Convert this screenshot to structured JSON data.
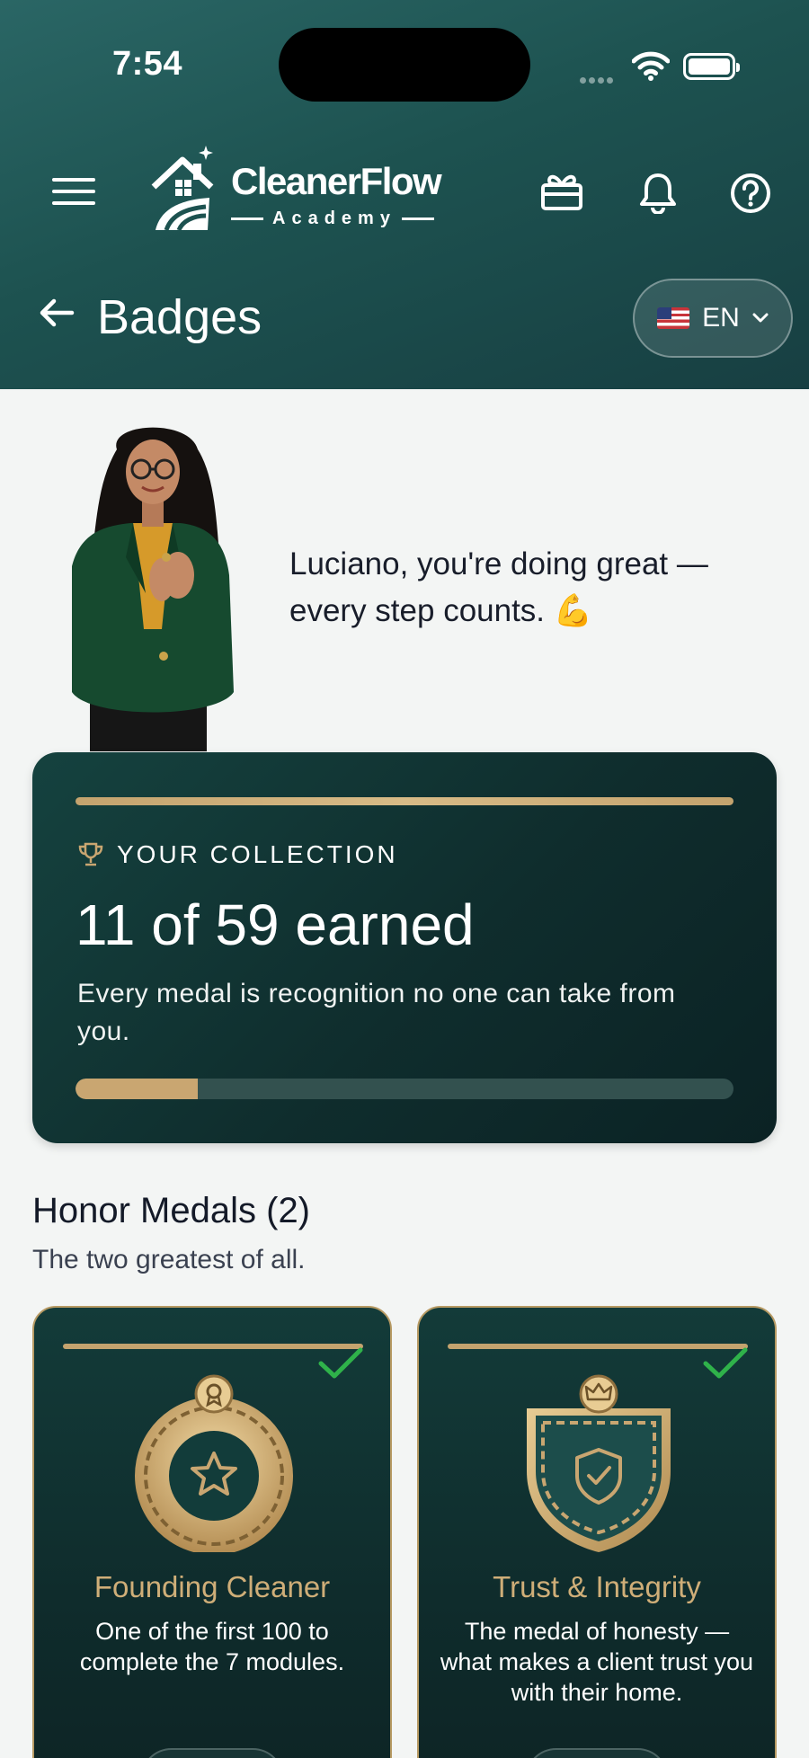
{
  "status_bar": {
    "time": "7:54"
  },
  "header": {
    "logo_title": "CleanerFlow",
    "logo_subtitle": "Academy",
    "page_title": "Badges",
    "language": "EN"
  },
  "mentor": {
    "message": "Luciano, you're doing great — every step counts. 💪"
  },
  "collection": {
    "kicker": "YOUR COLLECTION",
    "count_text": "11 of 59 earned",
    "earned": 11,
    "total": 59,
    "description": "Every medal is recognition no one can take from you."
  },
  "honor_section": {
    "title": "Honor Medals (2)",
    "subtitle": "The two greatest of all.",
    "medals": [
      {
        "name": "Founding Cleaner",
        "description": "One of the first 100 to complete the 7 modules.",
        "earned": true,
        "icon": "star-ring-medal-icon"
      },
      {
        "name": "Trust & Integrity",
        "description": "The medal of honesty — what makes a client trust you with their home.",
        "earned": true,
        "icon": "shield-check-medal-icon"
      }
    ]
  },
  "colors": {
    "header_bg": "#1d5250",
    "card_bg": "#0f2d2d",
    "gold": "#c9a671",
    "check_green": "#2fb24a",
    "page_bg": "#f3f5f4"
  }
}
